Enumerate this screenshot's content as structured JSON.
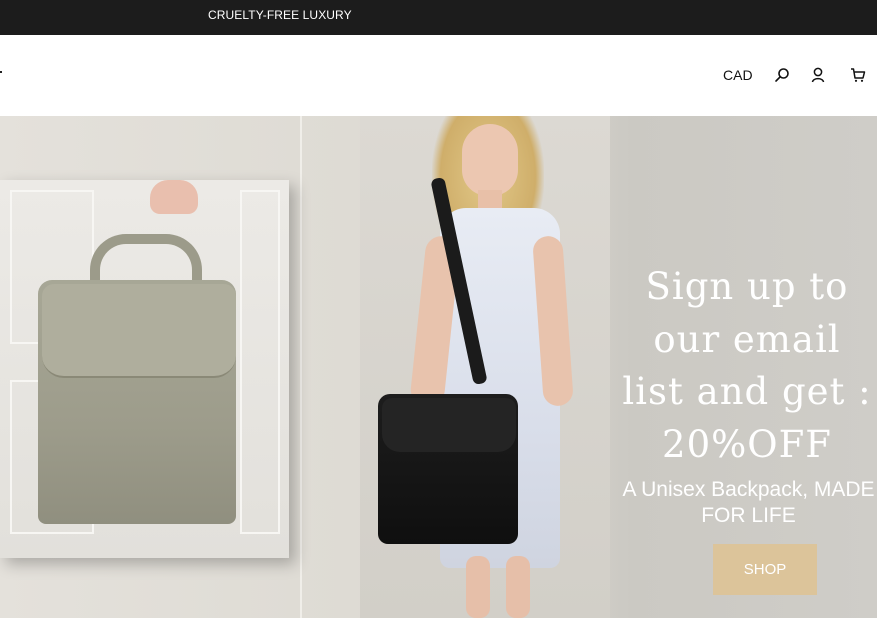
{
  "announcement": {
    "text": "CRUELTY-FREE LUXURY"
  },
  "header": {
    "currency": "CAD",
    "icons": [
      "search-icon",
      "account-icon",
      "cart-icon"
    ]
  },
  "hero": {
    "title": "Sign up to our email list and get : 20%OFF",
    "subtitle": "A Unisex Backpack, MADE FOR LIFE",
    "cta_label": "SHOP",
    "cta_color": "#dcc49a",
    "text_color": "#ffffff"
  },
  "colors": {
    "announcement_bg": "#1c1c1c",
    "header_bg": "#ffffff"
  }
}
